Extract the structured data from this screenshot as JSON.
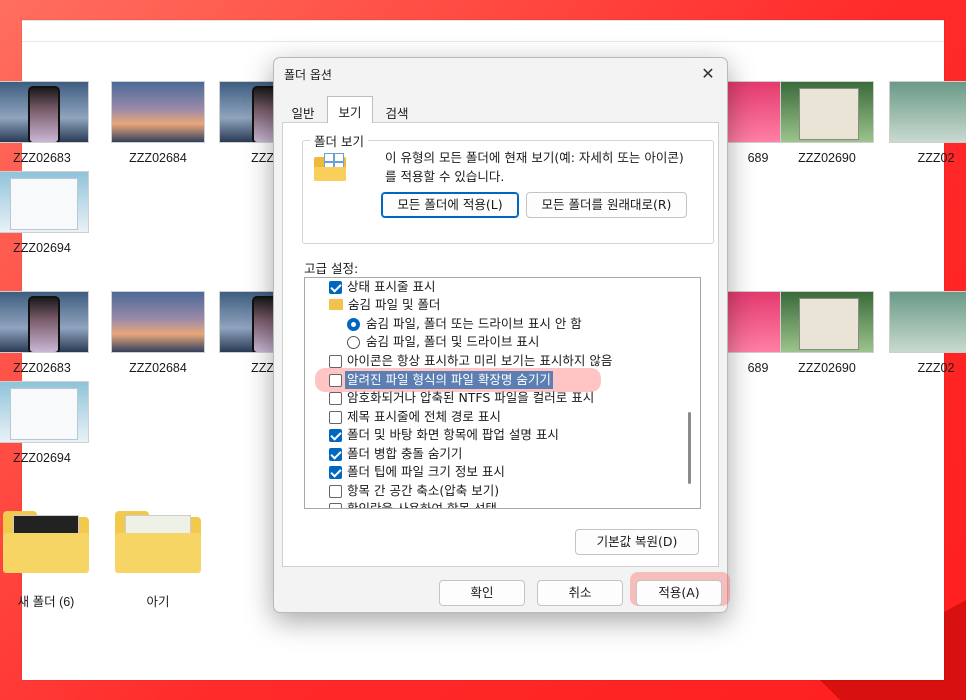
{
  "explorer": {
    "row1": [
      "ZZZ02683",
      "ZZZ02684",
      "ZZZ0",
      "689",
      "ZZZ02690",
      "ZZZ02"
    ],
    "row1b": [
      "ZZZ02694"
    ],
    "row2": [
      "ZZZ02683",
      "ZZZ02684",
      "ZZZ0",
      "689",
      "ZZZ02690",
      "ZZZ02"
    ],
    "row2b": [
      "ZZZ02694"
    ],
    "folders": [
      "새 폴더 (6)",
      "아기"
    ]
  },
  "dialog": {
    "title": "폴더 옵션",
    "close_glyph": "✕",
    "tabs": [
      "일반",
      "보기",
      "검색"
    ],
    "active_tab": "보기",
    "folder_view": {
      "label": "폴더 보기",
      "icon": "folder-view-icon",
      "description": "이 유형의 모든 폴더에 현재 보기(예: 자세히 또는 아이콘)를 적용할 수 있습니다.",
      "apply_all_button": "모든 폴더에 적용(L)",
      "reset_button": "모든 폴더를 원래대로(R)"
    },
    "advanced_label": "고급 설정:",
    "settings": [
      {
        "kind": "check",
        "checked": true,
        "text": "상태 표시줄 표시"
      },
      {
        "kind": "folder",
        "text": "숨김 파일 및 폴더"
      },
      {
        "kind": "radio",
        "checked": true,
        "text": "숨김 파일, 폴더 또는 드라이브 표시 안 함"
      },
      {
        "kind": "radio",
        "checked": false,
        "text": "숨김 파일, 폴더 및 드라이브 표시"
      },
      {
        "kind": "check",
        "checked": false,
        "text": "아이콘은 항상 표시하고 미리 보기는 표시하지 않음"
      },
      {
        "kind": "check",
        "checked": false,
        "text": "알려진 파일 형식의 파일 확장명 숨기기",
        "selected": true
      },
      {
        "kind": "check",
        "checked": false,
        "text": "암호화되거나 압축된 NTFS 파일을 컬러로 표시"
      },
      {
        "kind": "check",
        "checked": false,
        "text": "제목 표시줄에 전체 경로 표시"
      },
      {
        "kind": "check",
        "checked": true,
        "text": "폴더 및 바탕 화면 항목에 팝업 설명 표시"
      },
      {
        "kind": "check",
        "checked": true,
        "text": "폴더 병합 충돌 숨기기"
      },
      {
        "kind": "check",
        "checked": true,
        "text": "폴더 팁에 파일 크기 정보 표시"
      },
      {
        "kind": "check",
        "checked": false,
        "text": "항목 간 공간 축소(압축 보기)"
      },
      {
        "kind": "check",
        "checked": false,
        "text": "확인란을 사용하여 항목 선택"
      }
    ],
    "restore_defaults_button": "기본값 복원(D)",
    "ok_button": "확인",
    "cancel_button": "취소",
    "apply_button": "적용(A)"
  },
  "colors": {
    "accent": "#0067c0",
    "highlight": "#ff5a5a",
    "selection": "#5b7fb2"
  }
}
